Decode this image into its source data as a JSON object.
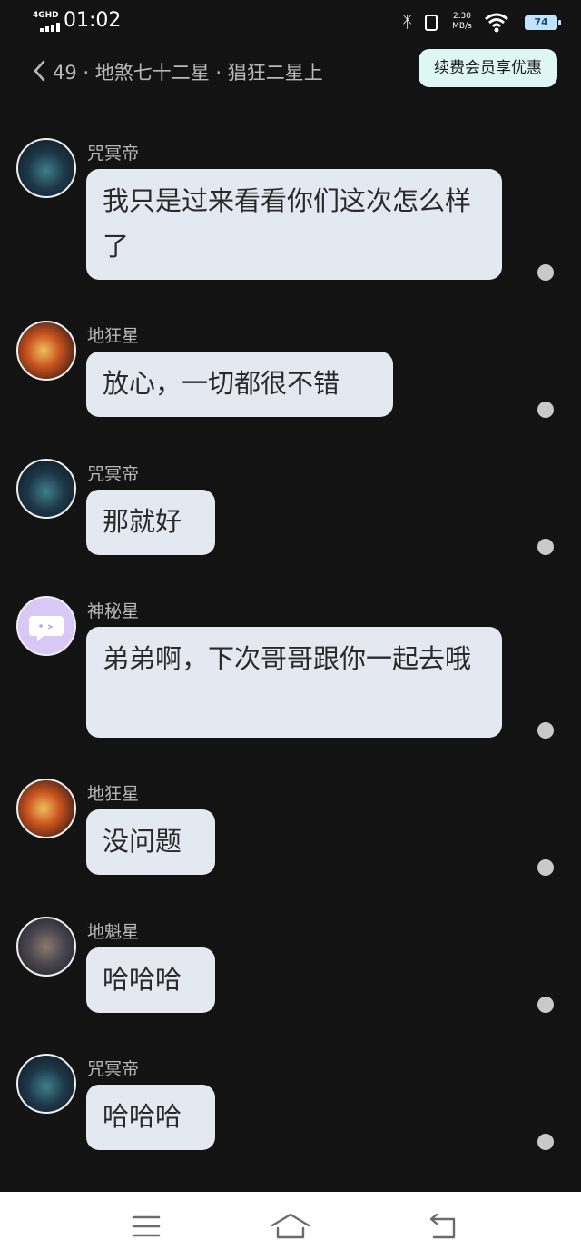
{
  "status": {
    "network": "4GHD",
    "time": "01:02",
    "speed_value": "2.30",
    "speed_unit": "MB/s",
    "battery": "74"
  },
  "header": {
    "title": "49 · 地煞七十二星 · 猖狂二星上",
    "vip_label": "续费会员享优惠"
  },
  "messages": [
    {
      "sender": "咒冥帝",
      "text": "我只是过来看看你们这次怎么样了",
      "avatar": "avatar-hooded-figure"
    },
    {
      "sender": "地狂星",
      "text": "放心，一切都很不错",
      "avatar": "avatar-fire-character"
    },
    {
      "sender": "咒冥帝",
      "text": "那就好",
      "avatar": "avatar-hooded-figure"
    },
    {
      "sender": "神秘星",
      "text": "弟弟啊，下次哥哥跟你一起去哦",
      "avatar": "avatar-speech-bubble-face"
    },
    {
      "sender": "地狂星",
      "text": "没问题",
      "avatar": "avatar-fire-character"
    },
    {
      "sender": "地魁星",
      "text": "哈哈哈",
      "avatar": "avatar-armored-character"
    },
    {
      "sender": "咒冥帝",
      "text": "哈哈哈",
      "avatar": "avatar-hooded-figure"
    }
  ],
  "colors": {
    "background": "#131313",
    "bubble": "#e4e8f0",
    "vip_button": "#dff7f4",
    "name_text": "#b8b8b8"
  },
  "navbar": {
    "icons": [
      "menu-icon",
      "home-icon",
      "back-icon"
    ]
  }
}
